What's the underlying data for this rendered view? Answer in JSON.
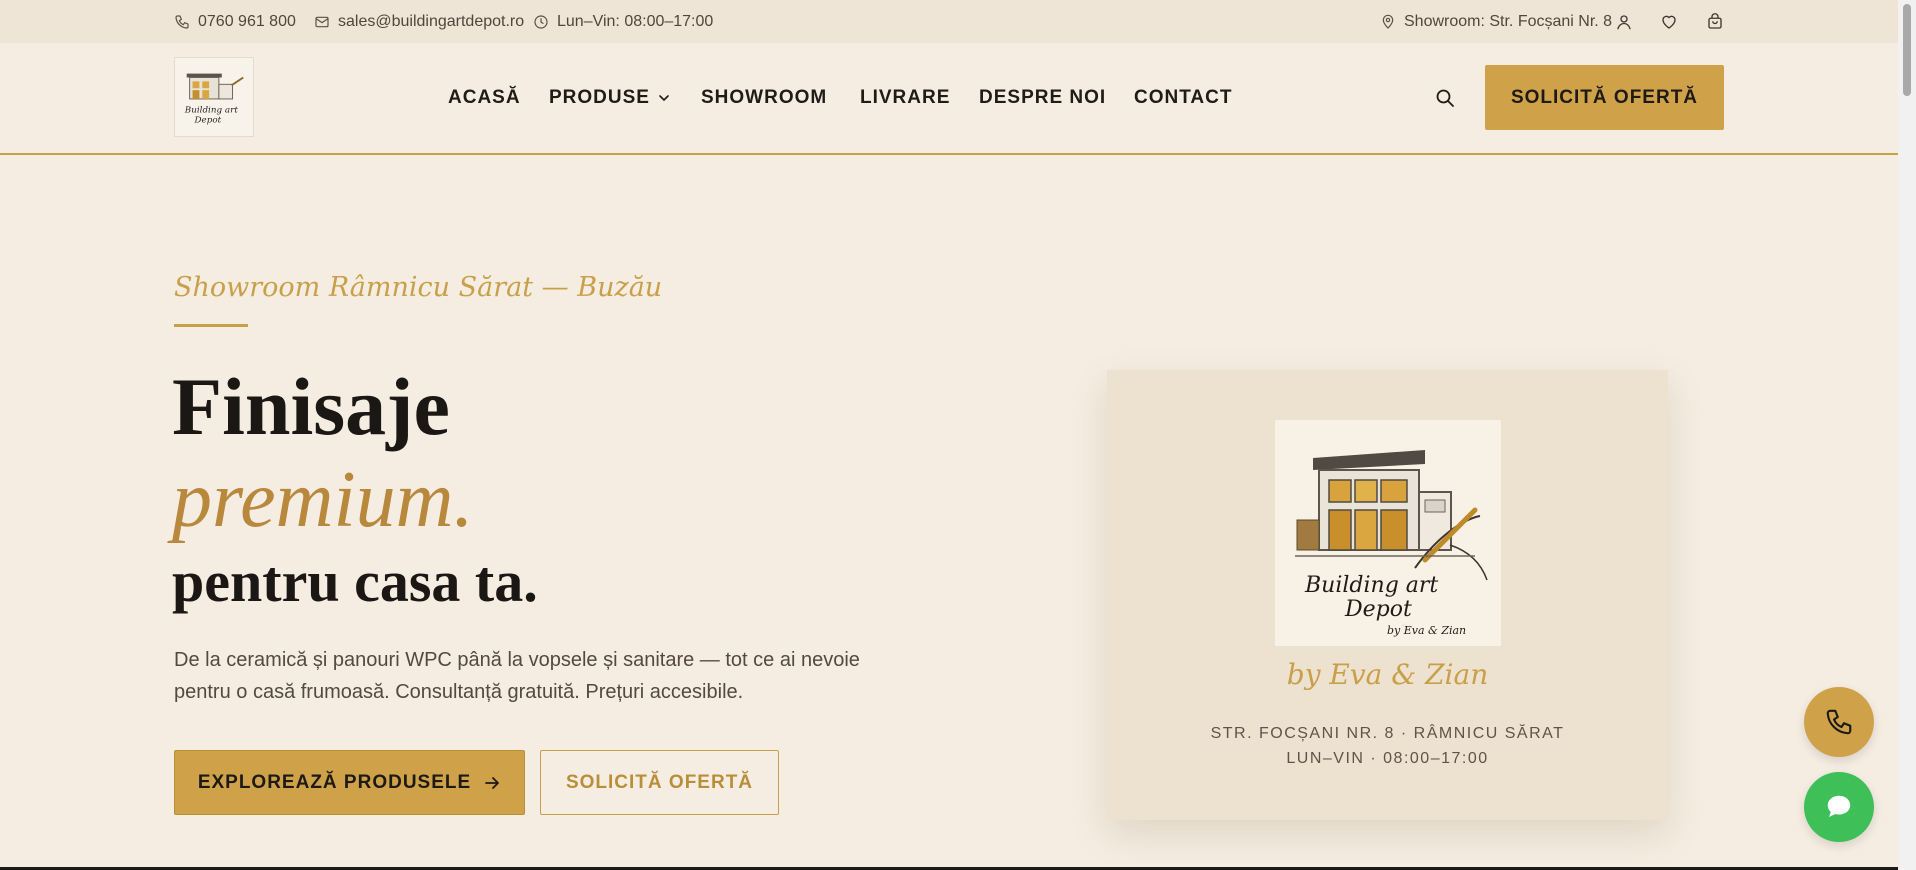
{
  "topbar": {
    "phone": "0760 961 800",
    "email": "sales@buildingartdepot.ro",
    "hours": "Lun–Vin: 08:00–17:00",
    "showroom": "Showroom: Str. Focșani Nr. 8"
  },
  "nav": {
    "items": [
      {
        "label": "ACASĂ"
      },
      {
        "label": "PRODUSE"
      },
      {
        "label": "SHOWROOM"
      },
      {
        "label": "LIVRARE"
      },
      {
        "label": "DESPRE NOI"
      },
      {
        "label": "CONTACT"
      }
    ],
    "cta": "SOLICITĂ OFERTĂ"
  },
  "hero": {
    "eyebrow": "Showroom Râmnicu Sărat — Buzău",
    "title_line1": "Finisaje",
    "title_line2": "premium.",
    "title_line3": "pentru casa ta.",
    "lead": "De la ceramică și panouri WPC până la vopsele și sanitare — tot ce ai nevoie pentru o casă frumoasă. Consultanță gratuită. Prețuri accesibile.",
    "primary_button": "EXPLOREAZĂ PRODUSELE",
    "secondary_button": "SOLICITĂ OFERTĂ"
  },
  "card": {
    "logo_text_1": "Building art",
    "logo_text_2": "Depot",
    "logo_text_3": "by Eva & Zian",
    "signature": "by Eva & Zian",
    "address": "STR. FOCȘANI NR. 8 · RÂMNICU SĂRAT",
    "hours": "LUN–VIN · 08:00–17:00"
  },
  "colors": {
    "accent": "#cfa249",
    "background": "#f5ede2",
    "topbar": "#efe5d6",
    "card": "#ede1cf",
    "chat": "#3fbf58"
  }
}
